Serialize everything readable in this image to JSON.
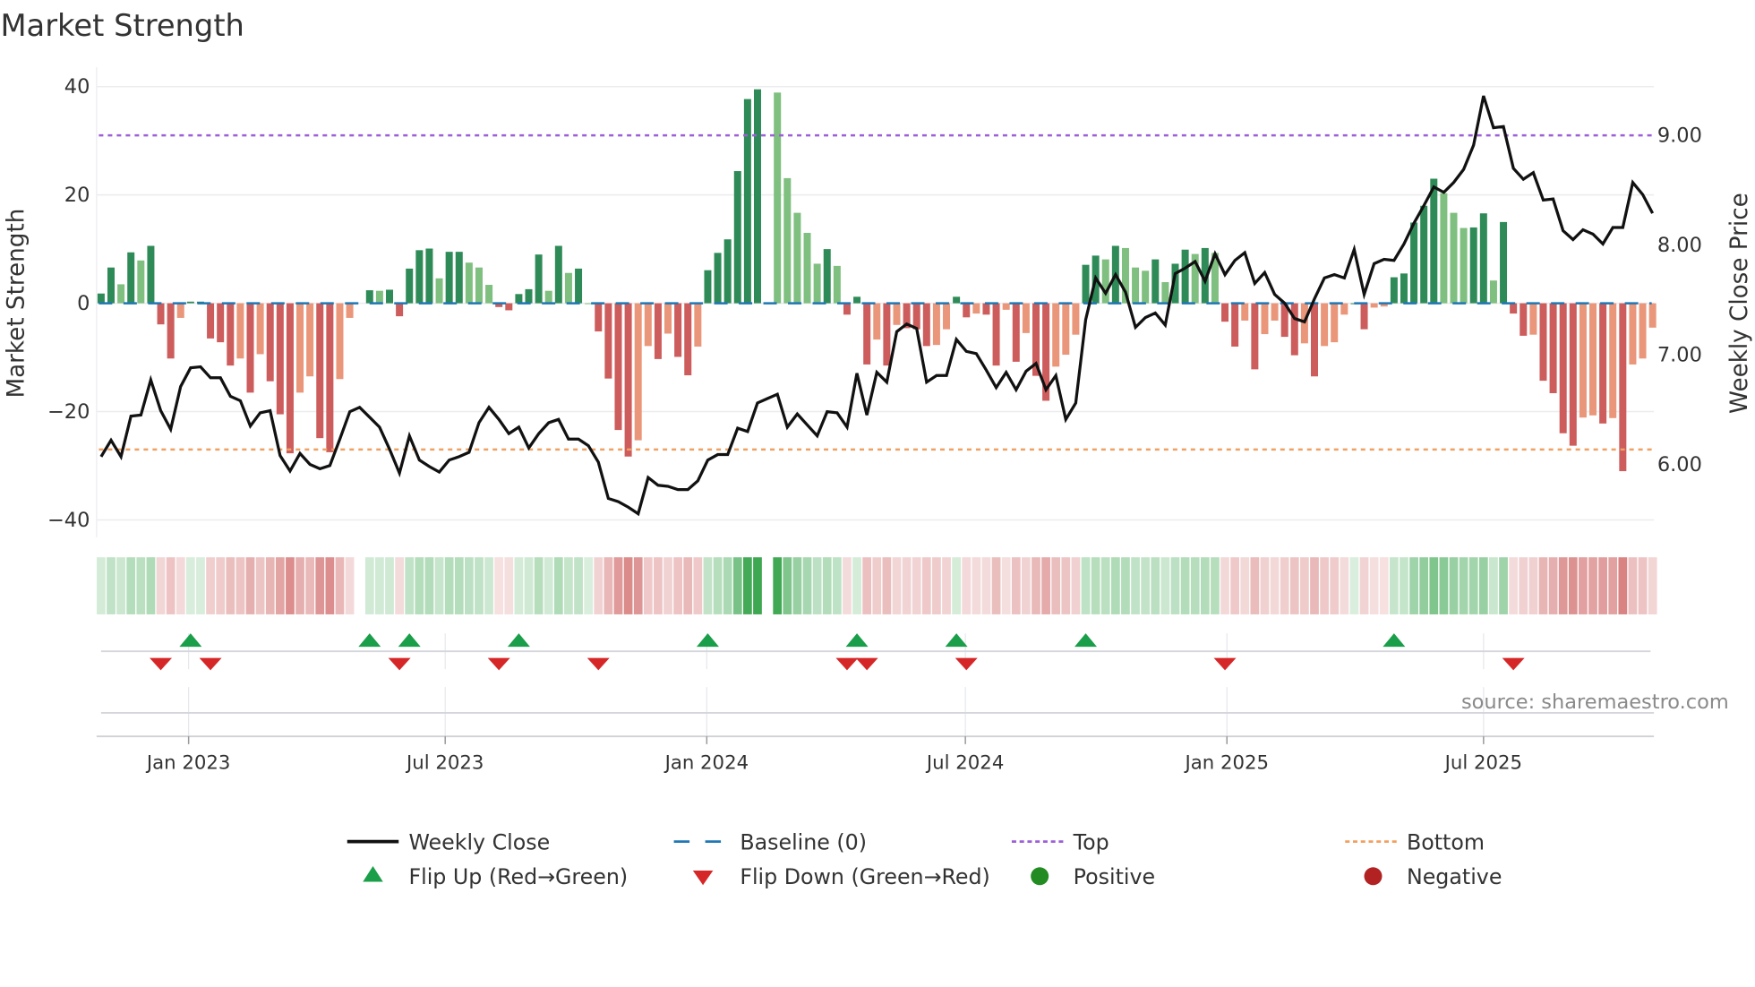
{
  "chart_data": {
    "type": "bar",
    "title": "Market Strength",
    "ylabel": "Market Strength",
    "y2label": "Weekly Close Price",
    "ylim": [
      -43,
      42
    ],
    "y2lim": [
      5.5,
      9.6
    ],
    "yticks": [
      40,
      20,
      0,
      -20,
      -40
    ],
    "ytick_labels": [
      "40",
      "20",
      "0",
      "−20",
      "−40"
    ],
    "y2ticks": [
      9.0,
      8.0,
      7.0,
      6.0
    ],
    "y2tick_labels": [
      "9.00",
      "8.00",
      "7.00",
      "6.00"
    ],
    "x_unit": "week index",
    "xticks": [
      {
        "week": 8.8,
        "label": "Jan 2023"
      },
      {
        "week": 34.6,
        "label": "Jul 2023"
      },
      {
        "week": 60.9,
        "label": "Jan 2024"
      },
      {
        "week": 86.9,
        "label": "Jul 2024"
      },
      {
        "week": 113.2,
        "label": "Jan 2025"
      },
      {
        "week": 139.0,
        "label": "Jul 2025"
      }
    ],
    "top_level": 31,
    "bottom_level": -27,
    "baseline": 0,
    "strength": [
      1.8,
      6.6,
      3.5,
      9.4,
      7.9,
      10.6,
      -3.9,
      -10.2,
      -2.7,
      0.3,
      0.3,
      -6.5,
      -7.2,
      -11.5,
      -10.2,
      -16.5,
      -9.4,
      -14.4,
      -20.5,
      -27.7,
      -16.5,
      -13.5,
      -24.9,
      -27.5,
      -14,
      -2.7,
      null,
      2.4,
      2.3,
      2.5,
      -2.4,
      6.4,
      9.8,
      10.1,
      4.6,
      9.5,
      9.5,
      7.5,
      6.6,
      3.4,
      -0.7,
      -1.3,
      1.7,
      2.6,
      9,
      2.3,
      10.6,
      5.6,
      6.4,
      0,
      -5.2,
      -13.9,
      -23.4,
      -28.3,
      -25.3,
      -7.9,
      -10.3,
      -5.6,
      -9.9,
      -13.3,
      -8,
      6.1,
      9.3,
      11.8,
      24.4,
      37.7,
      39.5,
      null,
      38.9,
      23.1,
      16.7,
      13,
      7.3,
      10,
      6.9,
      -2.1,
      1.2,
      -11.3,
      -6.7,
      -11.5,
      -4,
      -4.6,
      -4.8,
      -7.9,
      -7.7,
      -4.8,
      1.2,
      -2.6,
      -1.9,
      -2.1,
      -11.5,
      -1.2,
      -10.8,
      -5.5,
      -13.4,
      -18,
      -11.7,
      -9.5,
      -5.8,
      7.1,
      8.8,
      8.1,
      10.6,
      10.2,
      6.6,
      6,
      8.1,
      3.9,
      7.3,
      9.9,
      9.1,
      10.2,
      9.3,
      -3.4,
      -8,
      -3.2,
      -12.2,
      -5.7,
      -3.2,
      -6.2,
      -9.6,
      -7.4,
      -13.5,
      -7.9,
      -7.2,
      -2.1,
      0,
      -4.8,
      -0.8,
      -0.6,
      4.8,
      5.5,
      14.9,
      18,
      23,
      20.3,
      16.7,
      13.9,
      14,
      16.6,
      4.2,
      15,
      -1.9,
      -6,
      -5.8,
      -14.3,
      -16.6,
      -24,
      -26.3,
      -21.1,
      -20.7,
      -22.2,
      -21.2,
      -31,
      -11.3,
      -10.2,
      -4.5
    ],
    "weekly_close": [
      6.06,
      6.21,
      6.06,
      6.43,
      6.44,
      6.76,
      6.48,
      6.31,
      6.7,
      6.87,
      6.88,
      6.78,
      6.78,
      6.61,
      6.57,
      6.34,
      6.46,
      6.48,
      6.07,
      5.93,
      6.09,
      5.99,
      5.95,
      5.98,
      6.22,
      6.47,
      6.51,
      6.42,
      6.33,
      6.13,
      5.91,
      6.25,
      6.03,
      5.97,
      5.92,
      6.03,
      6.06,
      6.1,
      6.37,
      6.51,
      6.4,
      6.27,
      6.33,
      6.14,
      6.27,
      6.37,
      6.4,
      6.22,
      6.22,
      6.16,
      6.01,
      5.68,
      5.65,
      5.6,
      5.54,
      5.87,
      5.8,
      5.79,
      5.76,
      5.76,
      5.84,
      6.03,
      6.08,
      6.08,
      6.32,
      6.29,
      6.55,
      6.59,
      6.63,
      6.33,
      6.45,
      6.35,
      6.25,
      6.47,
      6.46,
      6.33,
      6.82,
      6.44,
      6.83,
      6.74,
      7.2,
      7.27,
      7.23,
      6.74,
      6.8,
      6.8,
      7.13,
      7.02,
      7.0,
      6.85,
      6.69,
      6.83,
      6.67,
      6.84,
      6.91,
      6.67,
      6.8,
      6.4,
      6.55,
      7.31,
      7.69,
      7.55,
      7.72,
      7.56,
      7.24,
      7.33,
      7.37,
      7.26,
      7.73,
      7.78,
      7.84,
      7.66,
      7.91,
      7.72,
      7.85,
      7.92,
      7.64,
      7.74,
      7.54,
      7.46,
      7.32,
      7.29,
      7.5,
      7.69,
      7.72,
      7.69,
      7.95,
      7.54,
      7.82,
      7.86,
      7.85,
      8.0,
      8.19,
      8.35,
      8.52,
      8.47,
      8.56,
      8.68,
      8.9,
      9.35,
      9.06,
      9.07,
      8.69,
      8.59,
      8.65,
      8.4,
      8.41,
      8.12,
      8.04,
      8.13,
      8.09,
      8.0,
      8.15,
      8.15,
      8.56,
      8.45,
      8.28
    ],
    "flip_up_weeks": [
      9,
      27,
      31,
      42,
      61,
      76,
      86,
      99,
      130
    ],
    "flip_down_weeks": [
      6,
      11,
      30,
      40,
      50,
      75,
      77,
      87,
      113,
      142
    ],
    "legend_placement": "bottom-center",
    "legend": [
      {
        "key": "weekly_close",
        "label": "Weekly Close",
        "symbol": "line"
      },
      {
        "key": "baseline",
        "label": "Baseline (0)",
        "symbol": "dash"
      },
      {
        "key": "top",
        "label": "Top",
        "symbol": "dot-purple"
      },
      {
        "key": "bottom",
        "label": "Bottom",
        "symbol": "dot-orange"
      },
      {
        "key": "flip_up",
        "label": "Flip Up (Red→Green)",
        "symbol": "triangle-up"
      },
      {
        "key": "flip_down",
        "label": "Flip Down (Green→Red)",
        "symbol": "triangle-down"
      },
      {
        "key": "positive",
        "label": "Positive",
        "symbol": "circle-green"
      },
      {
        "key": "negative",
        "label": "Negative",
        "symbol": "circle-red"
      }
    ],
    "source": "source: sharemaestro.com",
    "grid": true
  },
  "colors": {
    "pos_strong": "#2e8b57",
    "pos_weak": "#7fbf7f",
    "neg_strong": "#cd5c5c",
    "neg_weak": "#e9967a",
    "price": "#111111",
    "baseline": "#1f77b4",
    "top": "#9b5fd8",
    "bottom": "#f0a060",
    "flip_up": "#1a9e4a",
    "flip_down": "#d62728",
    "positive": "#228b22",
    "negative": "#b22222"
  }
}
